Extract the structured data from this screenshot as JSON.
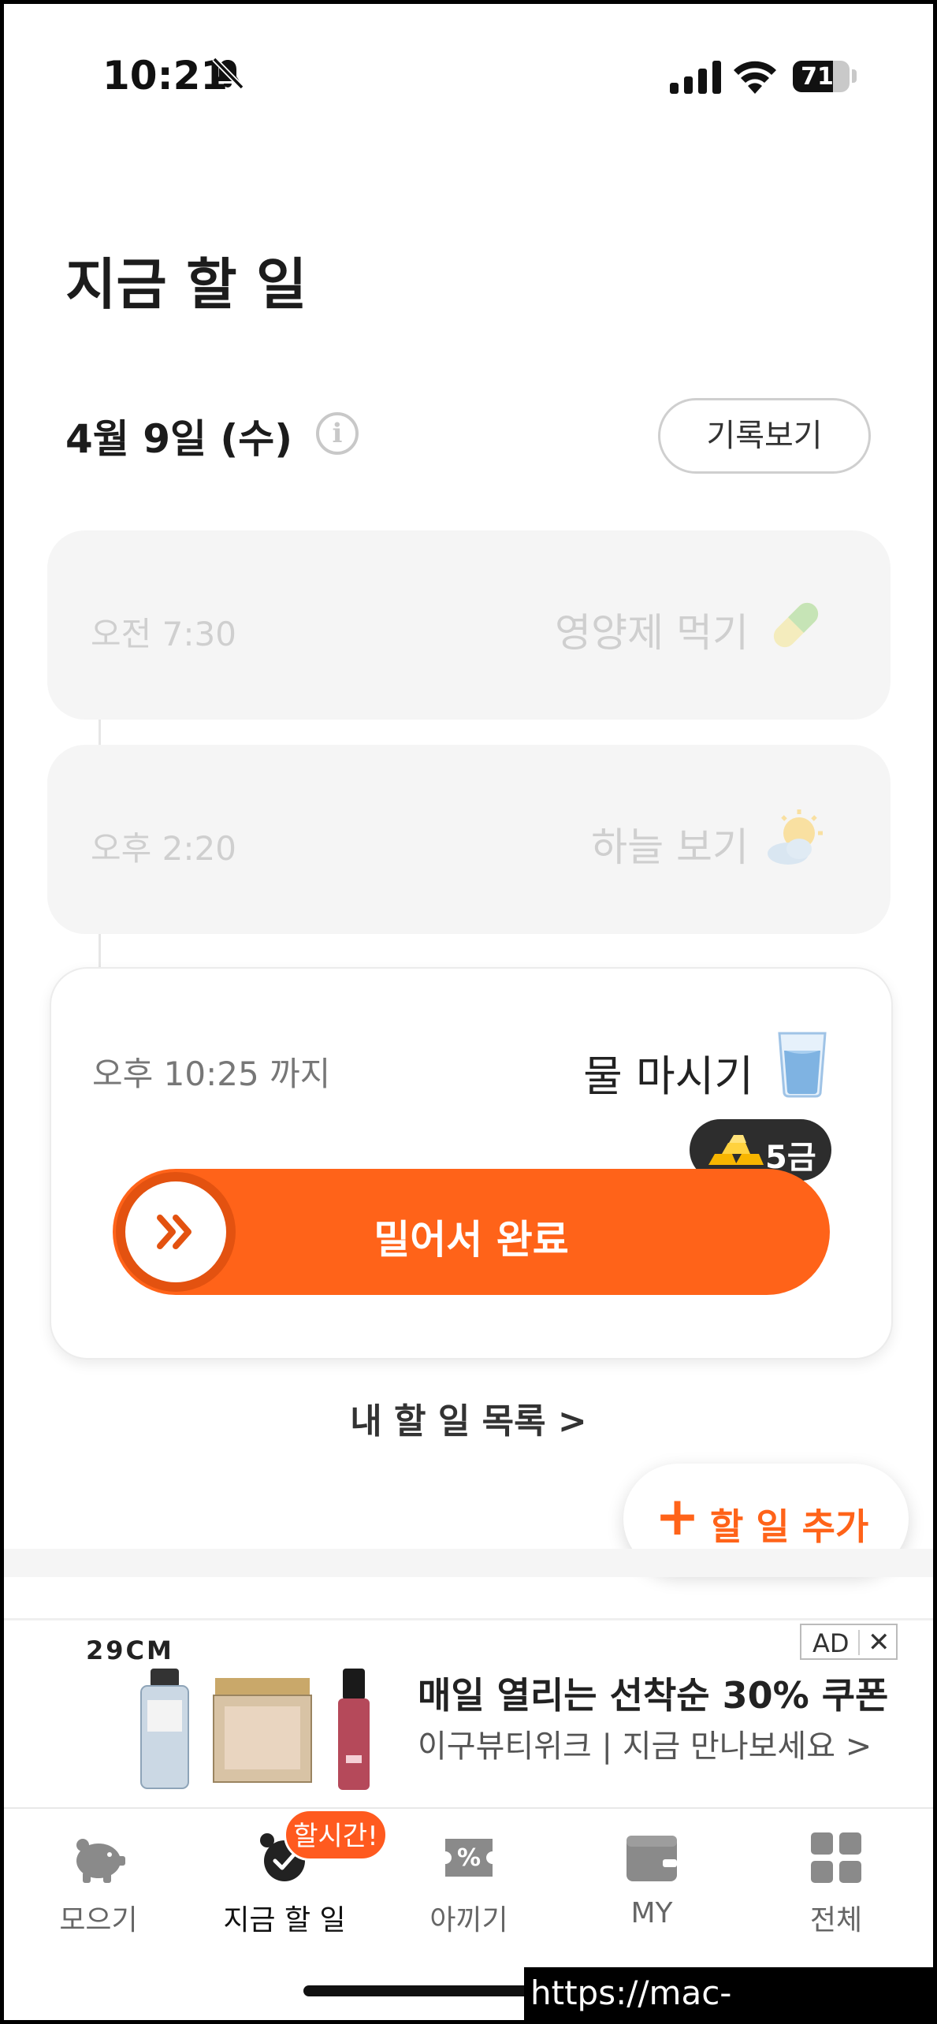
{
  "status_bar": {
    "time": "10:21",
    "battery": "71",
    "battery_level": 0.71,
    "icons": [
      "bell-slash-icon",
      "signal-icon",
      "wifi-icon",
      "battery-icon"
    ]
  },
  "page_title": "지금 할 일",
  "date_label": "4월 9일 (수)",
  "info_symbol": "i",
  "history_button": "기록보기",
  "completed_tasks": [
    {
      "time": "오전 7:30",
      "name": "영양제 먹기",
      "icon": "pill-icon"
    },
    {
      "time": "오후 2:20",
      "name": "하늘 보기",
      "icon": "sun-cloud-icon"
    }
  ],
  "active_task": {
    "deadline": "오후 10:25 까지",
    "name": "물 마시기",
    "icon": "water-glass-icon",
    "reward": "5금",
    "slide_label": "밀어서 완료"
  },
  "my_list_link": "내 할 일 목록 >",
  "add_button": {
    "plus": "+",
    "label": "할 일 추가"
  },
  "ad": {
    "brand": "29CM",
    "headline": "매일 열리는 선착순 30% 쿠폰",
    "subline": "이구뷰티위크 | 지금 만나보세요 >",
    "ad_label": "AD",
    "close": "✕"
  },
  "tabbar": {
    "tabs": [
      {
        "label": "모으기",
        "icon": "piggy-bank-icon"
      },
      {
        "label": "지금 할 일",
        "icon": "alarm-clock-icon",
        "active": true
      },
      {
        "label": "아끼기",
        "icon": "coupon-icon"
      },
      {
        "label": "MY",
        "icon": "wallet-icon"
      },
      {
        "label": "전체",
        "icon": "grid-icon"
      }
    ],
    "badge": "할시간!"
  },
  "watermark": "https://mac-os.tistory.com",
  "colors": {
    "accent": "#ff6319",
    "badge_dark": "#2d2d2d",
    "muted": "#cfcfcf"
  }
}
